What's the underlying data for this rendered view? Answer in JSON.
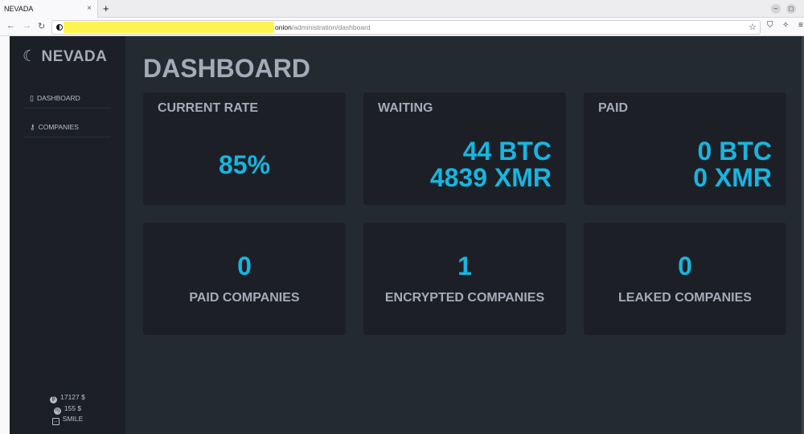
{
  "browser": {
    "tab_title": "NEVADA",
    "tab_close": "×",
    "new_tab": "+",
    "url_host_suffix": "onion",
    "url_path": "/administration/dashboard",
    "window_buttons": [
      "–",
      "◻",
      "×"
    ]
  },
  "sidebar": {
    "brand": "NEVADA",
    "brand_icon": "moon-icon",
    "items": [
      {
        "label": "DASHBOARD",
        "icon": "clipboard-icon"
      },
      {
        "label": "COMPANIES",
        "icon": "key-icon"
      }
    ],
    "footer": {
      "balance_btc": "17127 $",
      "balance_xmr": "155 $",
      "logout_label": "SMILE"
    }
  },
  "main": {
    "title": "DASHBOARD",
    "stats": {
      "current_rate": {
        "label": "CURRENT RATE",
        "value": "85%"
      },
      "waiting": {
        "label": "WAITING",
        "btc": "44 BTC",
        "xmr": "4839 XMR"
      },
      "paid": {
        "label": "PAID",
        "btc": "0 BTC",
        "xmr": "0 XMR"
      }
    },
    "counts": {
      "paid_companies": {
        "value": "0",
        "label": "PAID COMPANIES"
      },
      "encrypted_companies": {
        "value": "1",
        "label": "ENCRYPTED COMPANIES"
      },
      "leaked_companies": {
        "value": "0",
        "label": "LEAKED COMPANIES"
      }
    }
  },
  "colors": {
    "accent": "#18b5e0",
    "sidebar_bg": "#1c2026",
    "main_bg": "#232b31",
    "card_bg": "#1c2026",
    "label": "#a5aab8"
  }
}
